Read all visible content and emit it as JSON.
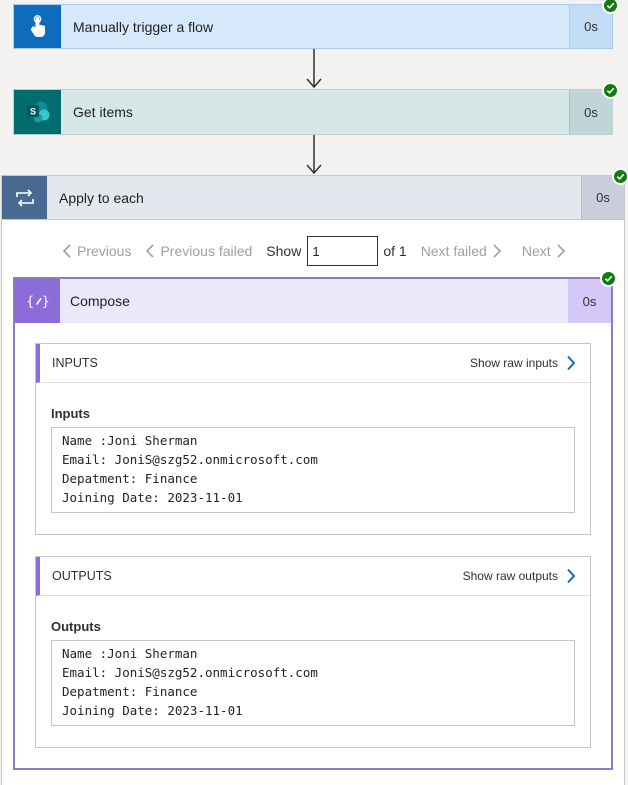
{
  "trigger": {
    "title": "Manually trigger a flow",
    "duration": "0s"
  },
  "get_items": {
    "title": "Get items",
    "duration": "0s"
  },
  "apply_each": {
    "title": "Apply to each",
    "duration": "0s",
    "pager": {
      "previous": "Previous",
      "previous_failed": "Previous failed",
      "show": "Show",
      "current": "1",
      "of": "of 1",
      "next_failed": "Next failed",
      "next": "Next"
    }
  },
  "compose": {
    "title": "Compose",
    "duration": "0s",
    "inputs": {
      "header": "INPUTS",
      "raw_link": "Show raw inputs",
      "sub_label": "Inputs",
      "lines": [
        "Name :Joni Sherman",
        "Email: JoniS@szg52.onmicrosoft.com",
        "Depatment: Finance",
        "Joining Date: 2023-11-01"
      ]
    },
    "outputs": {
      "header": "OUTPUTS",
      "raw_link": "Show raw outputs",
      "sub_label": "Outputs",
      "lines": [
        "Name :Joni Sherman",
        "Email: JoniS@szg52.onmicrosoft.com",
        "Depatment: Finance",
        "Joining Date: 2023-11-01"
      ]
    }
  },
  "colors": {
    "success": "#107c10",
    "trigger_icon_bg": "#0f6cbd",
    "sharepoint_icon_bg": "#036c70",
    "loop_icon_bg": "#486991",
    "compose_icon_bg": "#8c6cd8",
    "link_chevron": "#0f6cbd"
  },
  "icons": [
    "hand-touch-icon",
    "sharepoint-icon",
    "loop-icon",
    "compose-braces-icon",
    "success-check-icon",
    "chevron-right-icon",
    "chevron-left-icon",
    "down-arrow-icon"
  ]
}
